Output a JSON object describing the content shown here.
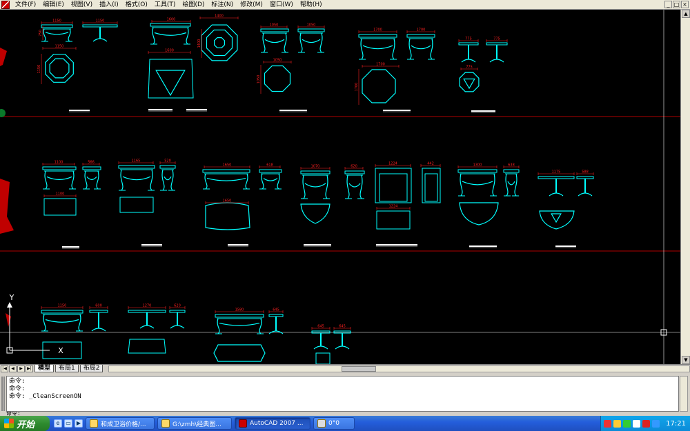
{
  "menubar": {
    "items": [
      "文件(F)",
      "编辑(E)",
      "视图(V)",
      "插入(I)",
      "格式(O)",
      "工具(T)",
      "绘图(D)",
      "标注(N)",
      "修改(M)",
      "窗口(W)",
      "帮助(H)"
    ],
    "window_buttons": [
      "_",
      "□",
      "×"
    ]
  },
  "drawing": {
    "background": "#000000",
    "line_color": "#00ffff",
    "dim_color": "#ff2020",
    "title_color": "#ffffff",
    "grid_lines": "#b00000",
    "ucs": {
      "y_label": "Y",
      "x_label": "X"
    },
    "dims_row1": [
      "1150",
      "1150",
      "1150",
      "1600",
      "1400",
      "1600",
      "1050",
      "1050",
      "1050",
      "1700",
      "1700",
      "1700",
      "775",
      "775",
      "775"
    ],
    "dims_row2": [
      "1100",
      "566",
      "1165",
      "520",
      "1650",
      "618",
      "1070",
      "620",
      "1224",
      "442",
      "1300",
      "638",
      "1175",
      "588"
    ],
    "dims_row3": [
      "1150",
      "600",
      "1270",
      "620",
      "1580",
      "645",
      "645",
      "645"
    ]
  },
  "tabs": {
    "nav": [
      "|◀",
      "◀",
      "▶",
      "▶|"
    ],
    "items": [
      "模型",
      "布局1",
      "布局2"
    ],
    "active_index": 0
  },
  "command": {
    "lines": [
      "命令:",
      "命令:",
      "命令: _CleanScreenON"
    ],
    "prompt": "命令:"
  },
  "taskbar": {
    "start_label": "开始",
    "quick_icons": [
      "ie-icon",
      "desktop-icon",
      "media-icon"
    ],
    "tasks": [
      {
        "label": "和成卫浴价格/...",
        "active": false
      },
      {
        "label": "G:\\zmh\\经典图...",
        "active": false
      },
      {
        "label": "AutoCAD 2007 ...",
        "active": true
      },
      {
        "label": "0°0",
        "active": false
      }
    ],
    "clock": "17:21"
  }
}
